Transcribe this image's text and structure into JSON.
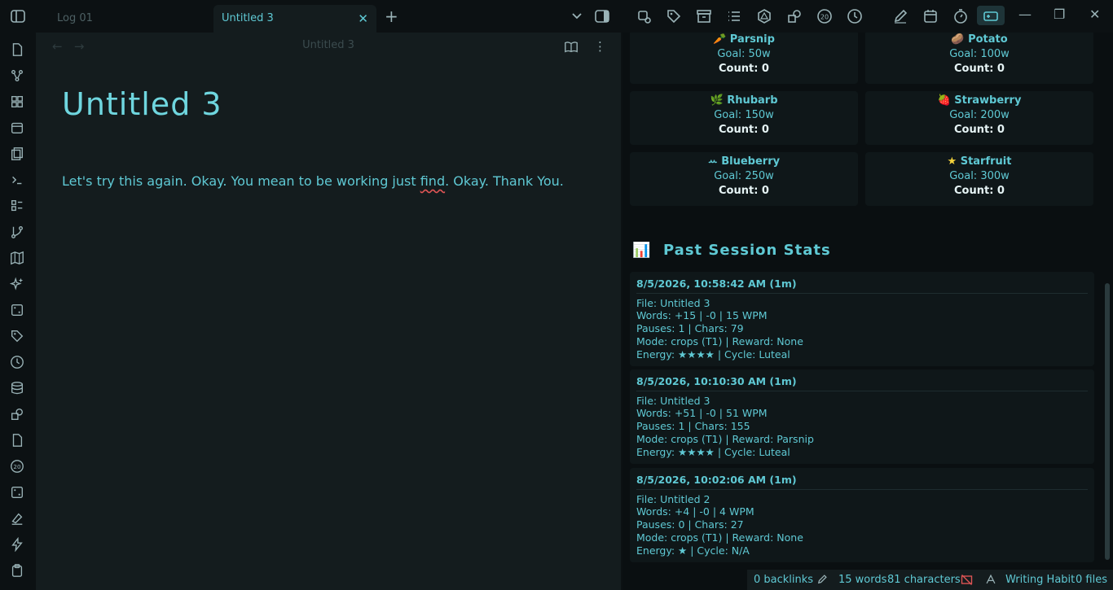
{
  "tabs": [
    {
      "label": "Log 01"
    },
    {
      "label": "Untitled 3"
    }
  ],
  "editor": {
    "header_title": "Untitled 3",
    "title": "Untitled 3",
    "body_before": "Let's try this again. Okay. You mean to be working just ",
    "body_misspelled": "find",
    "body_after": ". Okay. Thank You."
  },
  "crops": [
    {
      "emoji": "🥕",
      "name": "Parsnip",
      "goal": "Goal: 50w",
      "count": "Count: 0"
    },
    {
      "emoji": "🥔",
      "name": "Potato",
      "goal": "Goal: 100w",
      "count": "Count: 0"
    },
    {
      "emoji": "🌿",
      "name": "Rhubarb",
      "goal": "Goal: 150w",
      "count": "Count: 0"
    },
    {
      "emoji": "🍓",
      "name": "Strawberry",
      "goal": "Goal: 200w",
      "count": "Count: 0"
    },
    {
      "emoji": "ꕀ",
      "name": "Blueberry",
      "goal": "Goal: 250w",
      "count": "Count: 0"
    },
    {
      "emoji": "★",
      "name": "Starfruit",
      "goal": "Goal: 300w",
      "count": "Count: 0"
    }
  ],
  "stats": {
    "icon": "📊",
    "title": "Past Session Stats",
    "sessions": [
      {
        "head": "8/5/2026, 10:58:42 AM (1m)",
        "lines": [
          "File: Untitled 3",
          "Words: +15 | -0 | 15 WPM",
          "Pauses: 1 | Chars: 79",
          "Mode: crops (T1) | Reward: None",
          "Energy: ★★★★ | Cycle: Luteal"
        ]
      },
      {
        "head": "8/5/2026, 10:10:30 AM (1m)",
        "lines": [
          "File: Untitled 3",
          "Words: +51 | -0 | 51 WPM",
          "Pauses: 1 | Chars: 155",
          "Mode: crops (T1) | Reward: Parsnip",
          "Energy: ★★★★ | Cycle: Luteal"
        ]
      },
      {
        "head": "8/5/2026, 10:02:06 AM (1m)",
        "lines": [
          "File: Untitled 2",
          "Words: +4 | -0 | 4 WPM",
          "Pauses: 0 | Chars: 27",
          "Mode: crops (T1) | Reward: None",
          "Energy: ★ | Cycle: N/A"
        ]
      }
    ]
  },
  "status": {
    "backlinks": "0 backlinks",
    "words": "15 words",
    "chars": "81 characters",
    "plugin": "Writing Habit",
    "files": "0 files"
  }
}
